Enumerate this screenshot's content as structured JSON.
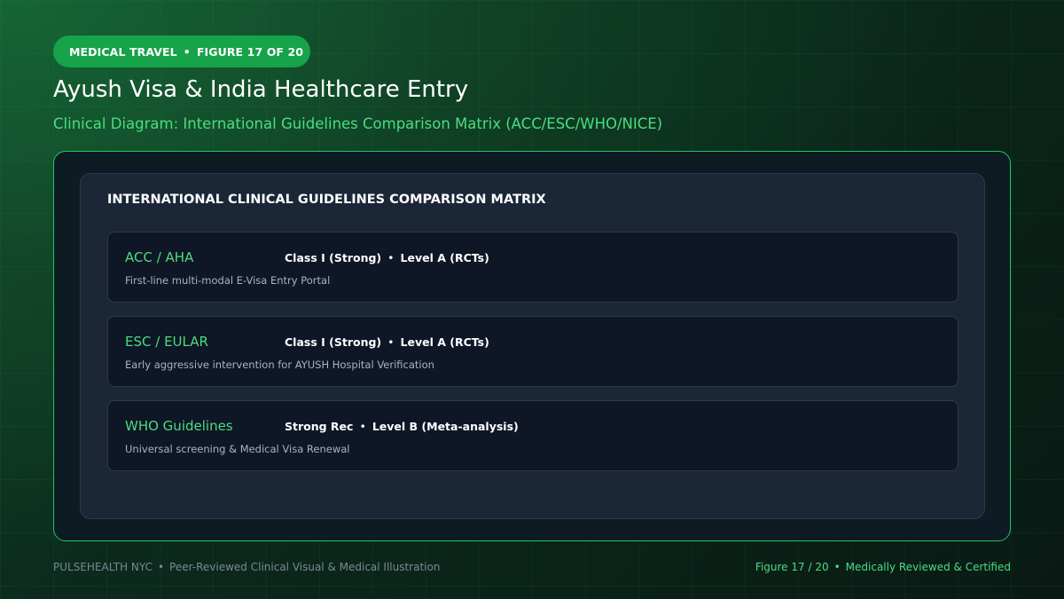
{
  "badge": {
    "category": "MEDICAL TRAVEL",
    "separator": "•",
    "figure": "FIGURE 17 OF 20"
  },
  "title": "Ayush Visa & India Healthcare Entry",
  "subtitle": "Clinical Diagram: International Guidelines Comparison Matrix (ACC/ESC/WHO/NICE)",
  "matrix": {
    "heading": "INTERNATIONAL CLINICAL GUIDELINES COMPARISON MATRIX",
    "rows": [
      {
        "org": "ACC / AHA",
        "strength": "Class I (Strong)",
        "separator": "•",
        "evidence": "Level A (RCTs)",
        "description": "First-line multi-modal E-Visa Entry Portal"
      },
      {
        "org": "ESC / EULAR",
        "strength": "Class I (Strong)",
        "separator": "•",
        "evidence": "Level A (RCTs)",
        "description": "Early aggressive intervention for AYUSH Hospital Verification"
      },
      {
        "org": "WHO Guidelines",
        "strength": "Strong Rec",
        "separator": "•",
        "evidence": "Level B (Meta-analysis)",
        "description": "Universal screening & Medical Visa Renewal"
      }
    ]
  },
  "footer": {
    "brand": "PULSEHEALTH NYC",
    "separator": "•",
    "tagline": "Peer-Reviewed Clinical Visual & Medical Illustration",
    "figure": "Figure 17 / 20",
    "certification": "Medically Reviewed & Certified"
  },
  "colors": {
    "accent": "#22c55e",
    "accent_text": "#4ade80",
    "badge_bg": "#16a34a",
    "panel_bg": "#1b2636",
    "card_bg": "#0f1626"
  }
}
